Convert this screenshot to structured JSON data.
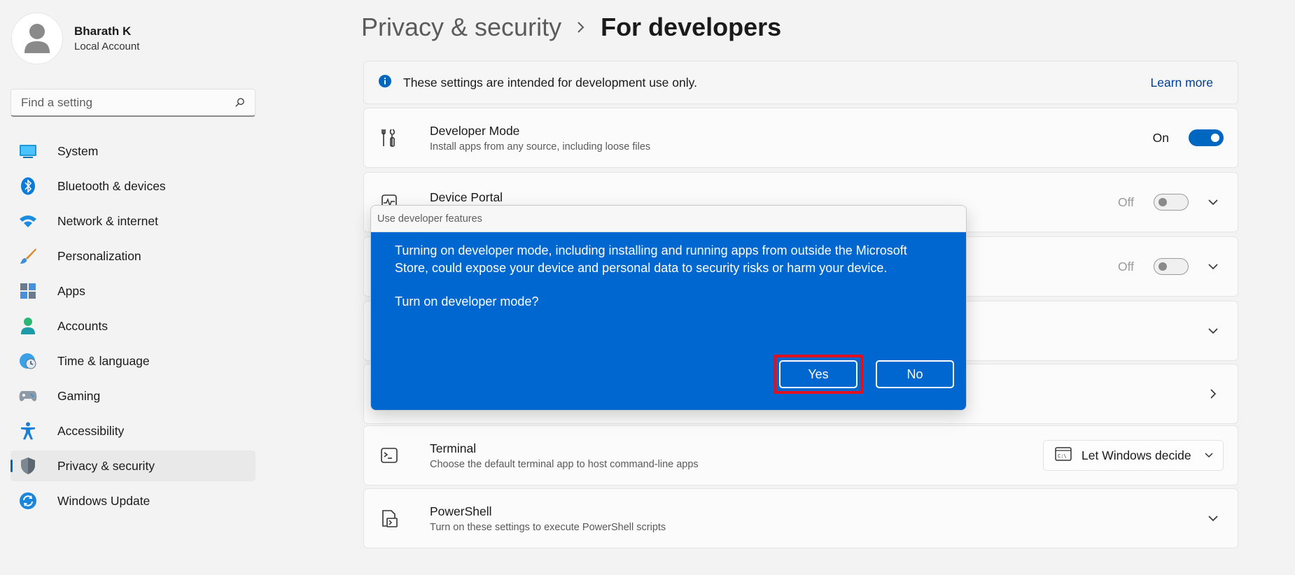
{
  "profile": {
    "name": "Bharath K",
    "account_type": "Local Account"
  },
  "search": {
    "placeholder": "Find a setting"
  },
  "sidebar": {
    "items": [
      {
        "label": "System",
        "icon": "system-icon"
      },
      {
        "label": "Bluetooth & devices",
        "icon": "bluetooth-icon"
      },
      {
        "label": "Network & internet",
        "icon": "wifi-icon"
      },
      {
        "label": "Personalization",
        "icon": "brush-icon"
      },
      {
        "label": "Apps",
        "icon": "apps-icon"
      },
      {
        "label": "Accounts",
        "icon": "accounts-icon"
      },
      {
        "label": "Time & language",
        "icon": "globe-clock-icon"
      },
      {
        "label": "Gaming",
        "icon": "gamepad-icon"
      },
      {
        "label": "Accessibility",
        "icon": "accessibility-icon"
      },
      {
        "label": "Privacy & security",
        "icon": "shield-icon",
        "active": true
      },
      {
        "label": "Windows Update",
        "icon": "update-icon"
      }
    ]
  },
  "header": {
    "parent": "Privacy & security",
    "current": "For developers"
  },
  "info": {
    "text": "These settings are intended for development use only.",
    "link": "Learn more"
  },
  "settings": {
    "developer_mode": {
      "title": "Developer Mode",
      "desc": "Install apps from any source, including loose files",
      "state": "On"
    },
    "device_portal": {
      "title": "Device Portal",
      "state": "Off"
    },
    "row3": {
      "state": "Off"
    },
    "terminal": {
      "title": "Terminal",
      "desc": "Choose the default terminal app to host command-line apps",
      "value": "Let Windows decide"
    },
    "powershell": {
      "title": "PowerShell",
      "desc": "Turn on these settings to execute PowerShell scripts"
    }
  },
  "dialog": {
    "title": "Use developer features",
    "message": "Turning on developer mode, including installing and running apps from outside the Microsoft Store, could expose your device and personal data to security risks or harm your device.",
    "question": "Turn on developer mode?",
    "yes": "Yes",
    "no": "No"
  },
  "colors": {
    "accent": "#0067c0",
    "dialog_bg": "#0067d0",
    "highlight": "#e0101e"
  }
}
